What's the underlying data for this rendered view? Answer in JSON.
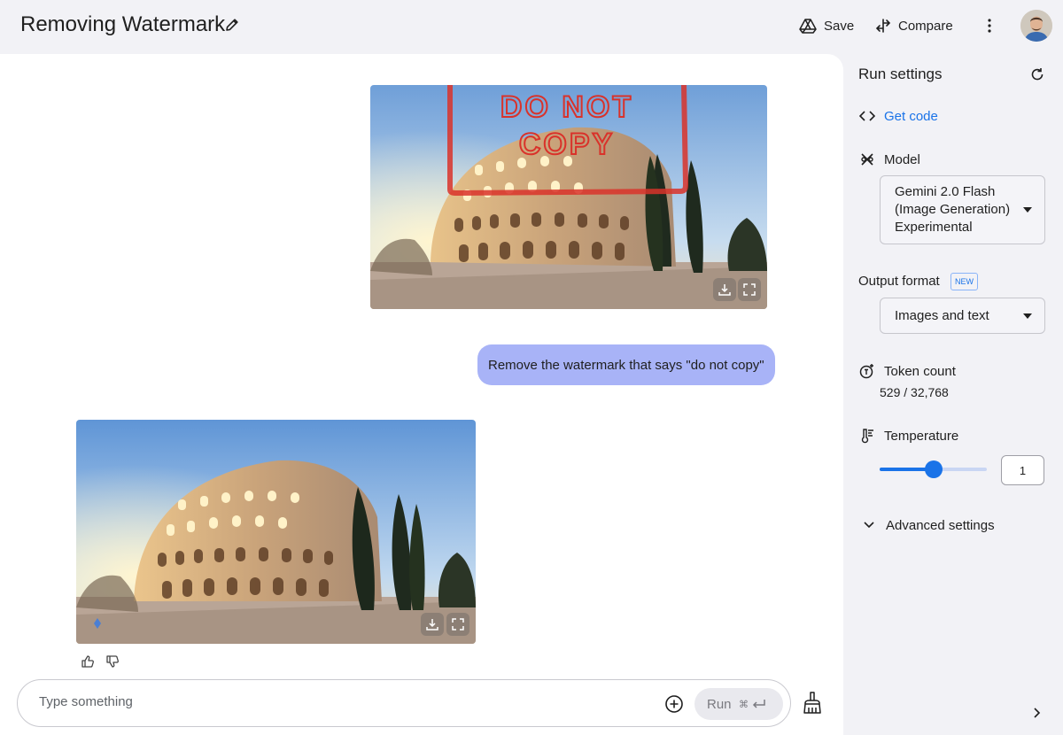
{
  "header": {
    "title": "Removing Watermark",
    "save_label": "Save",
    "compare_label": "Compare"
  },
  "chat": {
    "user_image": {
      "watermark_text_1": "DO NOT",
      "watermark_text_2": "COPY"
    },
    "user_message": "Remove the watermark that says \"do not copy\"",
    "composer": {
      "placeholder": "Type something",
      "run_label": "Run"
    }
  },
  "settings": {
    "title": "Run settings",
    "get_code_label": "Get code",
    "model_label": "Model",
    "model_value_lines": [
      "Gemini 2.0 Flash",
      "(Image Generation)",
      "Experimental"
    ],
    "output_format_label": "Output format",
    "new_badge": "NEW",
    "output_format_value": "Images and text",
    "token_count_label": "Token count",
    "token_count_value": "529 / 32,768",
    "temperature_label": "Temperature",
    "temperature_value": "1",
    "temperature_fraction": 0.5,
    "advanced_settings_label": "Advanced settings"
  },
  "colors": {
    "accent": "#1a73e8",
    "user_bubble": "#a8b3f7",
    "watermark": "#d9322a"
  }
}
